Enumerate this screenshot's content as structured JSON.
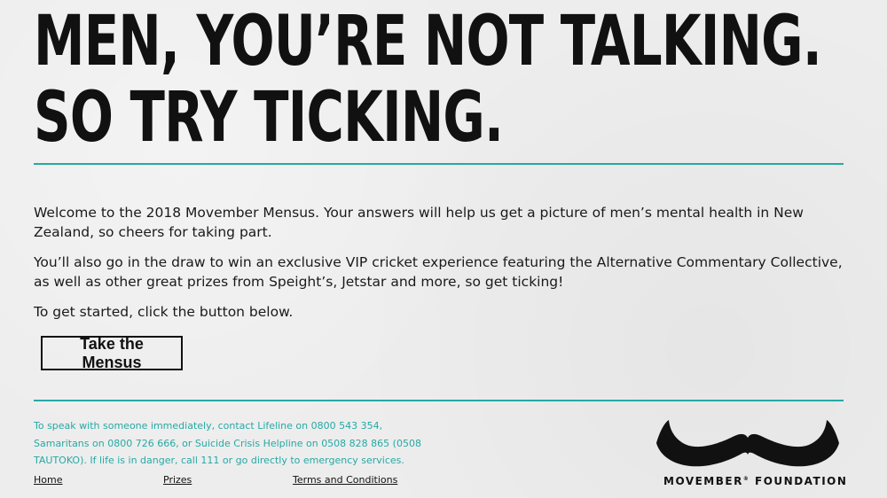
{
  "headline": {
    "line1": "MEN, YOU’RE NOT TALKING.",
    "line2": "SO TRY TICKING."
  },
  "intro": {
    "p1": "Welcome to the 2018 Movember Mensus. Your answers will help us get a picture of men’s mental health in New Zealand, so cheers for taking part.",
    "p2": "You’ll also go in the draw to win an exclusive VIP cricket experience featuring the Alternative Commentary Collective, as well as other great prizes from Speight’s, Jetstar and more, so get ticking!",
    "p3": "To get started, click the button below."
  },
  "cta": {
    "label": "Take the Mensus"
  },
  "help": {
    "text": "To speak with someone immediately, contact Lifeline on 0800 543 354, Samaritans on 0800 726 666, or Suicide Crisis Helpline on 0508 828 865 (0508 TAUTOKO). If life is in danger, call 111 or go directly to emergency services."
  },
  "footer_links": {
    "home": "Home",
    "prizes": "Prizes",
    "terms": "Terms and Conditions"
  },
  "logo": {
    "name": "MOVEMBER",
    "reg": "®",
    "suffix": " FOUNDATION"
  },
  "colors": {
    "accent": "#26a9a4",
    "text": "#111111",
    "background": "#ededed"
  }
}
